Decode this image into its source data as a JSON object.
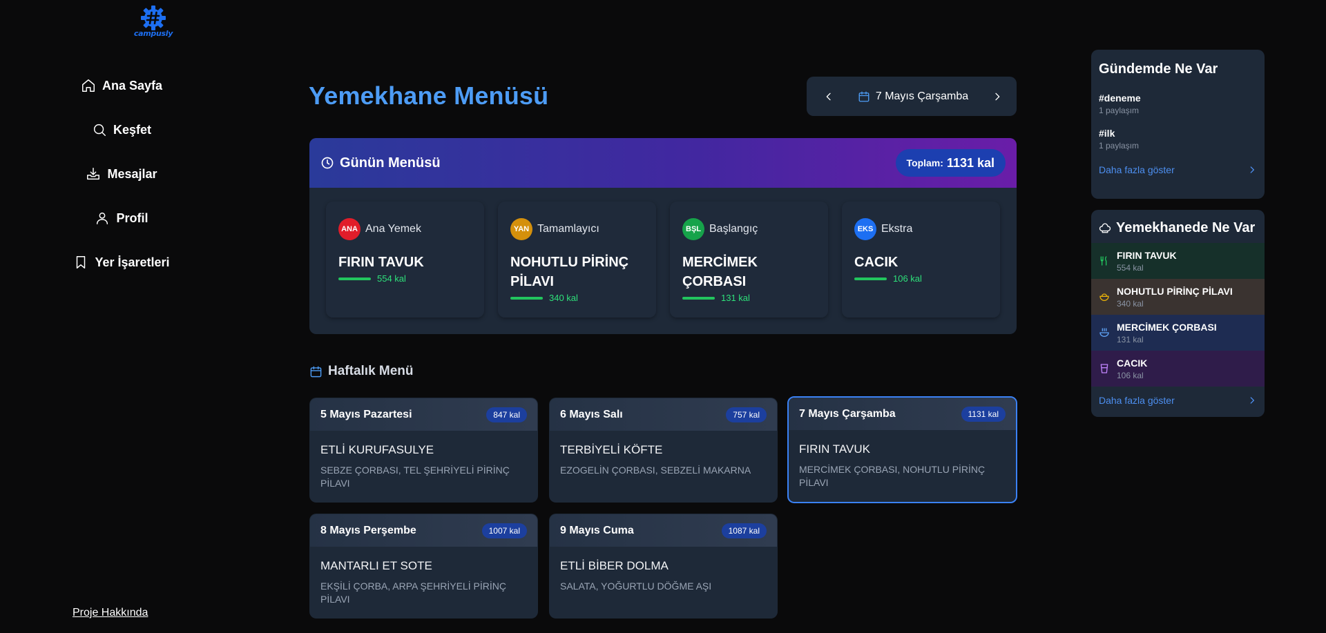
{
  "app": {
    "logo_text": "campusly"
  },
  "nav": {
    "items": [
      {
        "label": "Ana Sayfa",
        "icon": "home-icon"
      },
      {
        "label": "Keşfet",
        "icon": "search-icon"
      },
      {
        "label": "Mesajlar",
        "icon": "inbox-icon"
      },
      {
        "label": "Profil",
        "icon": "user-icon"
      },
      {
        "label": "Yer İşaretleri",
        "icon": "bookmark-icon"
      }
    ],
    "about": "Proje Hakkında"
  },
  "header": {
    "title": "Yemekhane Menüsü",
    "current_date": "7 Mayıs Çarşamba"
  },
  "daily": {
    "title": "Günün Menüsü",
    "total_label": "Toplam:",
    "total_value": "1131 kal",
    "dishes": [
      {
        "badge": "ANA",
        "badge_color": "#e11d2a",
        "category": "Ana Yemek",
        "name": "FIRIN TAVUK",
        "kal": "554 kal"
      },
      {
        "badge": "YAN",
        "badge_color": "#d4900c",
        "category": "Tamamlayıcı",
        "name": "NOHUTLU PİRİNÇ PİLAVI",
        "kal": "340 kal"
      },
      {
        "badge": "BŞL",
        "badge_color": "#16a34a",
        "category": "Başlangıç",
        "name": "MERCİMEK ÇORBASI",
        "kal": "131 kal"
      },
      {
        "badge": "EKS",
        "badge_color": "#1d6ff2",
        "category": "Ekstra",
        "name": "CACIK",
        "kal": "106 kal"
      }
    ]
  },
  "weekly": {
    "title": "Haftalık Menü",
    "days": [
      {
        "date": "5 Mayıs Pazartesi",
        "kal": "847 kal",
        "main": "ETLİ KURUFASULYE",
        "sides": "SEBZE ÇORBASI, TEL ŞEHRİYELİ PİRİNÇ PİLAVI"
      },
      {
        "date": "6 Mayıs Salı",
        "kal": "757 kal",
        "main": "TERBİYELİ KÖFTE",
        "sides": "EZOGELİN ÇORBASI, SEBZELİ MAKARNA"
      },
      {
        "date": "7 Mayıs Çarşamba",
        "kal": "1131 kal",
        "main": "FIRIN TAVUK",
        "sides": "MERCİMEK ÇORBASI, NOHUTLU PİRİNÇ PİLAVI",
        "active": true
      },
      {
        "date": "8 Mayıs Perşembe",
        "kal": "1007 kal",
        "main": "MANTARLI ET SOTE",
        "sides": "EKŞİLİ ÇORBA, ARPA ŞEHRİYELİ PİRİNÇ PİLAVI"
      },
      {
        "date": "9 Mayıs Cuma",
        "kal": "1087 kal",
        "main": "ETLİ BİBER DOLMA",
        "sides": "SALATA, YOĞURTLU DÖĞME AŞI"
      }
    ]
  },
  "trending": {
    "title": "Gündemde Ne Var",
    "tags": [
      {
        "name": "#deneme",
        "count": "1 paylaşım"
      },
      {
        "name": "#ilk",
        "count": "1 paylaşım"
      }
    ],
    "more": "Daha fazla göster"
  },
  "dining": {
    "title": "Yemekhanede Ne Var",
    "items": [
      {
        "name": "FIRIN TAVUK",
        "kal": "554 kal",
        "icon": "utensils-icon",
        "bg": "#16302a",
        "icon_color": "#22c55e"
      },
      {
        "name": "NOHUTLU PİRİNÇ PİLAVI",
        "kal": "340 kal",
        "icon": "rice-bowl-icon",
        "bg": "#3a3330",
        "icon_color": "#eab308"
      },
      {
        "name": "MERCİMEK ÇORBASI",
        "kal": "131 kal",
        "icon": "soup-icon",
        "bg": "#1e2c52",
        "icon_color": "#60a5fa"
      },
      {
        "name": "CACIK",
        "kal": "106 kal",
        "icon": "cup-icon",
        "bg": "#2f1c4a",
        "icon_color": "#c084fc"
      }
    ],
    "more": "Daha fazla göster"
  }
}
